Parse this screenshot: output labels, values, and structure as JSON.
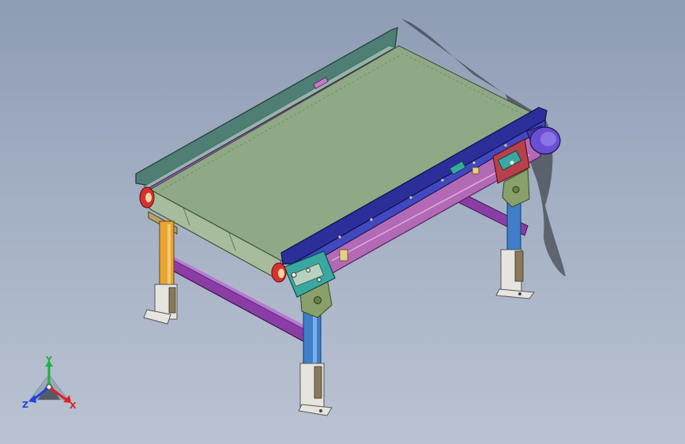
{
  "view": {
    "background_top": "#8e9cb4",
    "background_bottom": "#bac3d2"
  },
  "model": {
    "belt_color": "#8fa886",
    "frame_rail_color": "#2c2f9a",
    "side_guard_color": "#4f7e74",
    "side_plate_color": "#b36ab5",
    "crossbar_color": "#8a3ea5",
    "front_left_leg_color": "#e8a533",
    "front_right_leg_color": "#3f7fc9",
    "foot_color": "#e6e4de",
    "bracket_color": "#8aa06a",
    "end_roller_color": "#d83030",
    "motor_color": "#6a4fd0",
    "gear_color": "#3aa8a0"
  },
  "triad": {
    "y_label": "Y",
    "x_label": "X",
    "z_label": "Z",
    "x_color": "#e02020",
    "y_color": "#20b040",
    "z_color": "#2040e0"
  }
}
